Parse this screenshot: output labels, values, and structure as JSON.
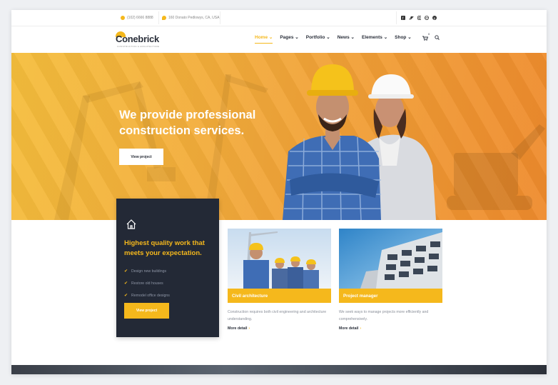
{
  "topbar": {
    "phone": "(102) 6666 8888",
    "address": "160 Donato Pedlowys, CA, USA",
    "social": [
      "f",
      "t",
      "ig",
      "dr",
      "p"
    ]
  },
  "nav": {
    "logo": "Conebrick",
    "logo_tagline": "CONSTRUCTION & ARCHITECTURE",
    "menu": [
      {
        "label": "Home",
        "active": true
      },
      {
        "label": "Pages"
      },
      {
        "label": "Portfolio"
      },
      {
        "label": "News"
      },
      {
        "label": "Elements"
      },
      {
        "label": "Shop"
      }
    ],
    "cart_count": "0"
  },
  "hero": {
    "title": "We provide professional construction services.",
    "button": "View project"
  },
  "card": {
    "title": "Highest quality work that meets your expectation.",
    "items": [
      "Design new buildings",
      "Restore old houses",
      "Remodel office designs"
    ],
    "button": "View project"
  },
  "services": [
    {
      "tag": "Civil architecture",
      "desc": "Construction requires both civil engineering and architecture understanding.",
      "more": "More detail"
    },
    {
      "tag": "Project manager",
      "desc": "We seek ways to manage projects more efficiently and comprehensively.",
      "more": "More detail"
    }
  ],
  "colors": {
    "accent": "#f5b81c",
    "dark": "#232936",
    "hero_from": "#f5be3c",
    "hero_to": "#ee8a2c"
  }
}
